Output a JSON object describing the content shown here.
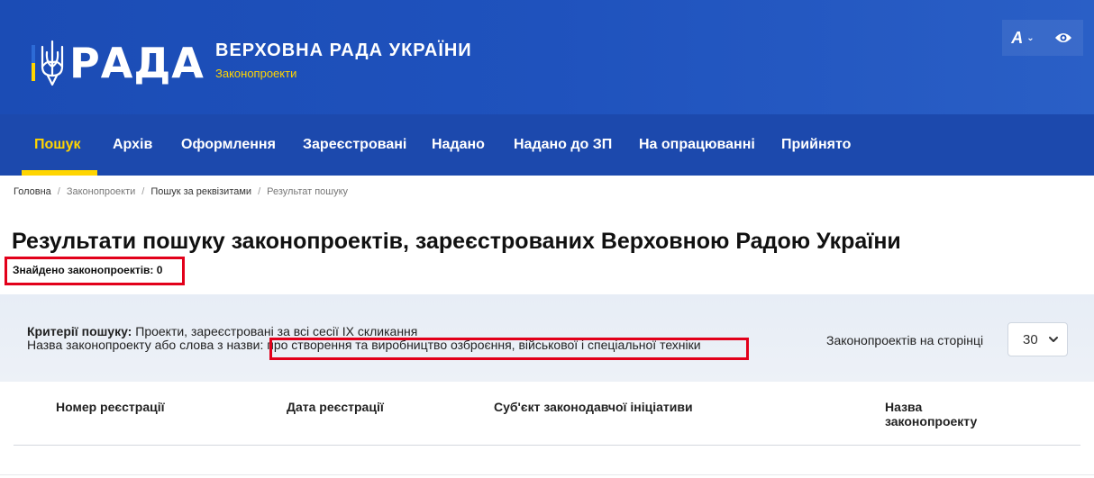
{
  "header": {
    "logo_word": "РАДА",
    "title": "ВЕРХОВНА РАДА УКРАЇНИ",
    "subtitle": "Законопроекти",
    "font_tool_label": "A"
  },
  "nav": {
    "items": [
      {
        "label": "Пошук",
        "active": true
      },
      {
        "label": "Архів"
      },
      {
        "label": "Оформлення"
      },
      {
        "label": "Зареєстровані"
      },
      {
        "label": "Надано"
      },
      {
        "label": "Надано до ЗП"
      },
      {
        "label": "На опрацюванні"
      },
      {
        "label": "Прийнято"
      }
    ]
  },
  "breadcrumb": [
    "Головна",
    "Законопроекти",
    "Пошук за реквізитами",
    "Результат пошуку"
  ],
  "page": {
    "title": "Результати пошуку законопроектів, зареєстрованих Верховною Радою України",
    "found_label": "Знайдено законопроектів: 0"
  },
  "criteria": {
    "label": "Критерії пошуку:",
    "value": "Проекти, зареєстровані за всі сесії IX скликання",
    "name_label": "Назва законопроекту або слова з назви:",
    "name_value": "про створення та виробництво озброєння, військової і спеціальної техніки",
    "per_page_label": "Законопроектів на сторінці",
    "per_page_value": "30"
  },
  "table": {
    "columns": [
      "Номер реєстрації",
      "Дата реєстрації",
      "Суб'єкт законодавчої ініціативи",
      "Назва законопроекту"
    ]
  },
  "colors": {
    "header_blue": "#1f52bd",
    "nav_blue": "#1c49ad",
    "accent_yellow": "#ffd500",
    "highlight_red": "#e2001a"
  }
}
